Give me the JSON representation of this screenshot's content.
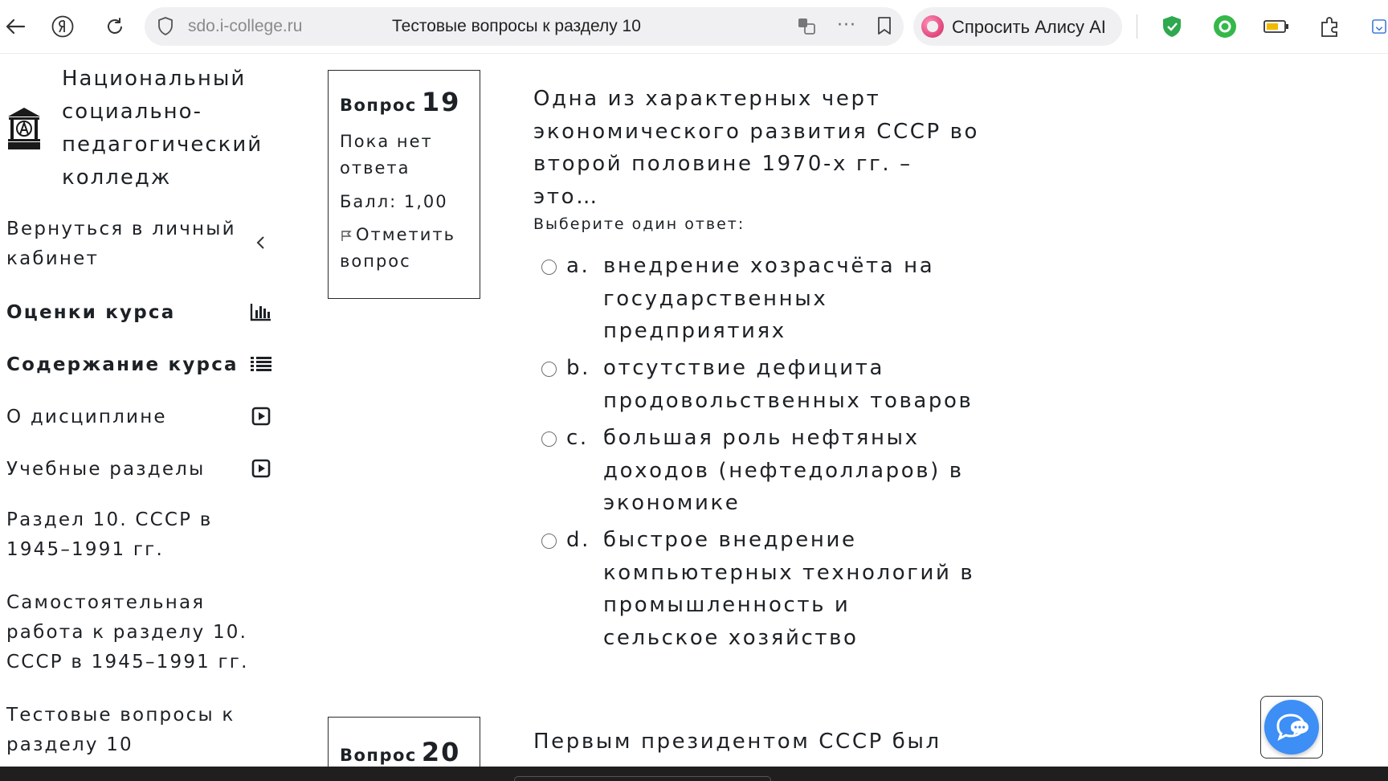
{
  "browser": {
    "host": "sdo.i-college.ru",
    "page_title": "Тестовые вопросы к разделу 10",
    "alice_label": "Спросить Алису AI"
  },
  "sidebar": {
    "college_name": "Национальный социально-педагогический колледж",
    "back_label": "Вернуться в личный кабинет",
    "items": [
      {
        "label": "Оценки курса",
        "icon": "bar-chart-icon",
        "bold": true
      },
      {
        "label": "Содержание курса",
        "icon": "list-icon",
        "bold": true
      },
      {
        "label": "О дисциплине",
        "icon": "play-box-icon",
        "bold": false
      },
      {
        "label": "Учебные разделы",
        "icon": "play-box-icon",
        "bold": false
      }
    ],
    "sections": [
      "Раздел 10. СССР в 1945–1991 гг.",
      "Самостоятельная работа к разделу 10. СССР в 1945–1991 гг.",
      "Тестовые вопросы к разделу 10"
    ]
  },
  "question19": {
    "label": "Вопрос",
    "number": "19",
    "state": "Пока нет ответа",
    "grade": "Балл: 1,00",
    "flag": "Отметить вопрос",
    "text": "Одна из характерных черт экономического развития СССР во второй половине 1970-х гг. – это…",
    "prompt": "Выберите один ответ:",
    "answers": [
      {
        "letter": "a.",
        "text": "внедрение хозрасчёта на государственных предприятиях"
      },
      {
        "letter": "b.",
        "text": "отсутствие дефицита продовольственных товаров"
      },
      {
        "letter": "c.",
        "text": "большая роль нефтяных доходов (нефтедолларов) в экономике"
      },
      {
        "letter": "d.",
        "text": "быстрое внедрение компьютерных технологий в промышленность и сельское хозяйство"
      }
    ]
  },
  "question20": {
    "label": "Вопрос",
    "number": "20",
    "text": "Первым президентом СССР был"
  }
}
